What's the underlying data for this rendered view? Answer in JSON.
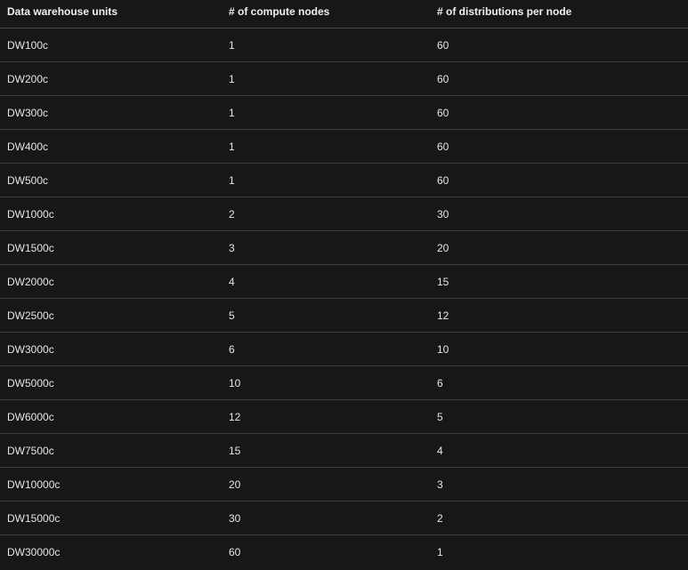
{
  "table": {
    "headers": [
      "Data warehouse units",
      "# of compute nodes",
      "# of distributions per node"
    ],
    "rows": [
      [
        "DW100c",
        "1",
        "60"
      ],
      [
        "DW200c",
        "1",
        "60"
      ],
      [
        "DW300c",
        "1",
        "60"
      ],
      [
        "DW400c",
        "1",
        "60"
      ],
      [
        "DW500c",
        "1",
        "60"
      ],
      [
        "DW1000c",
        "2",
        "30"
      ],
      [
        "DW1500c",
        "3",
        "20"
      ],
      [
        "DW2000c",
        "4",
        "15"
      ],
      [
        "DW2500c",
        "5",
        "12"
      ],
      [
        "DW3000c",
        "6",
        "10"
      ],
      [
        "DW5000c",
        "10",
        "6"
      ],
      [
        "DW6000c",
        "12",
        "5"
      ],
      [
        "DW7500c",
        "15",
        "4"
      ],
      [
        "DW10000c",
        "20",
        "3"
      ],
      [
        "DW15000c",
        "30",
        "2"
      ],
      [
        "DW30000c",
        "60",
        "1"
      ]
    ]
  }
}
